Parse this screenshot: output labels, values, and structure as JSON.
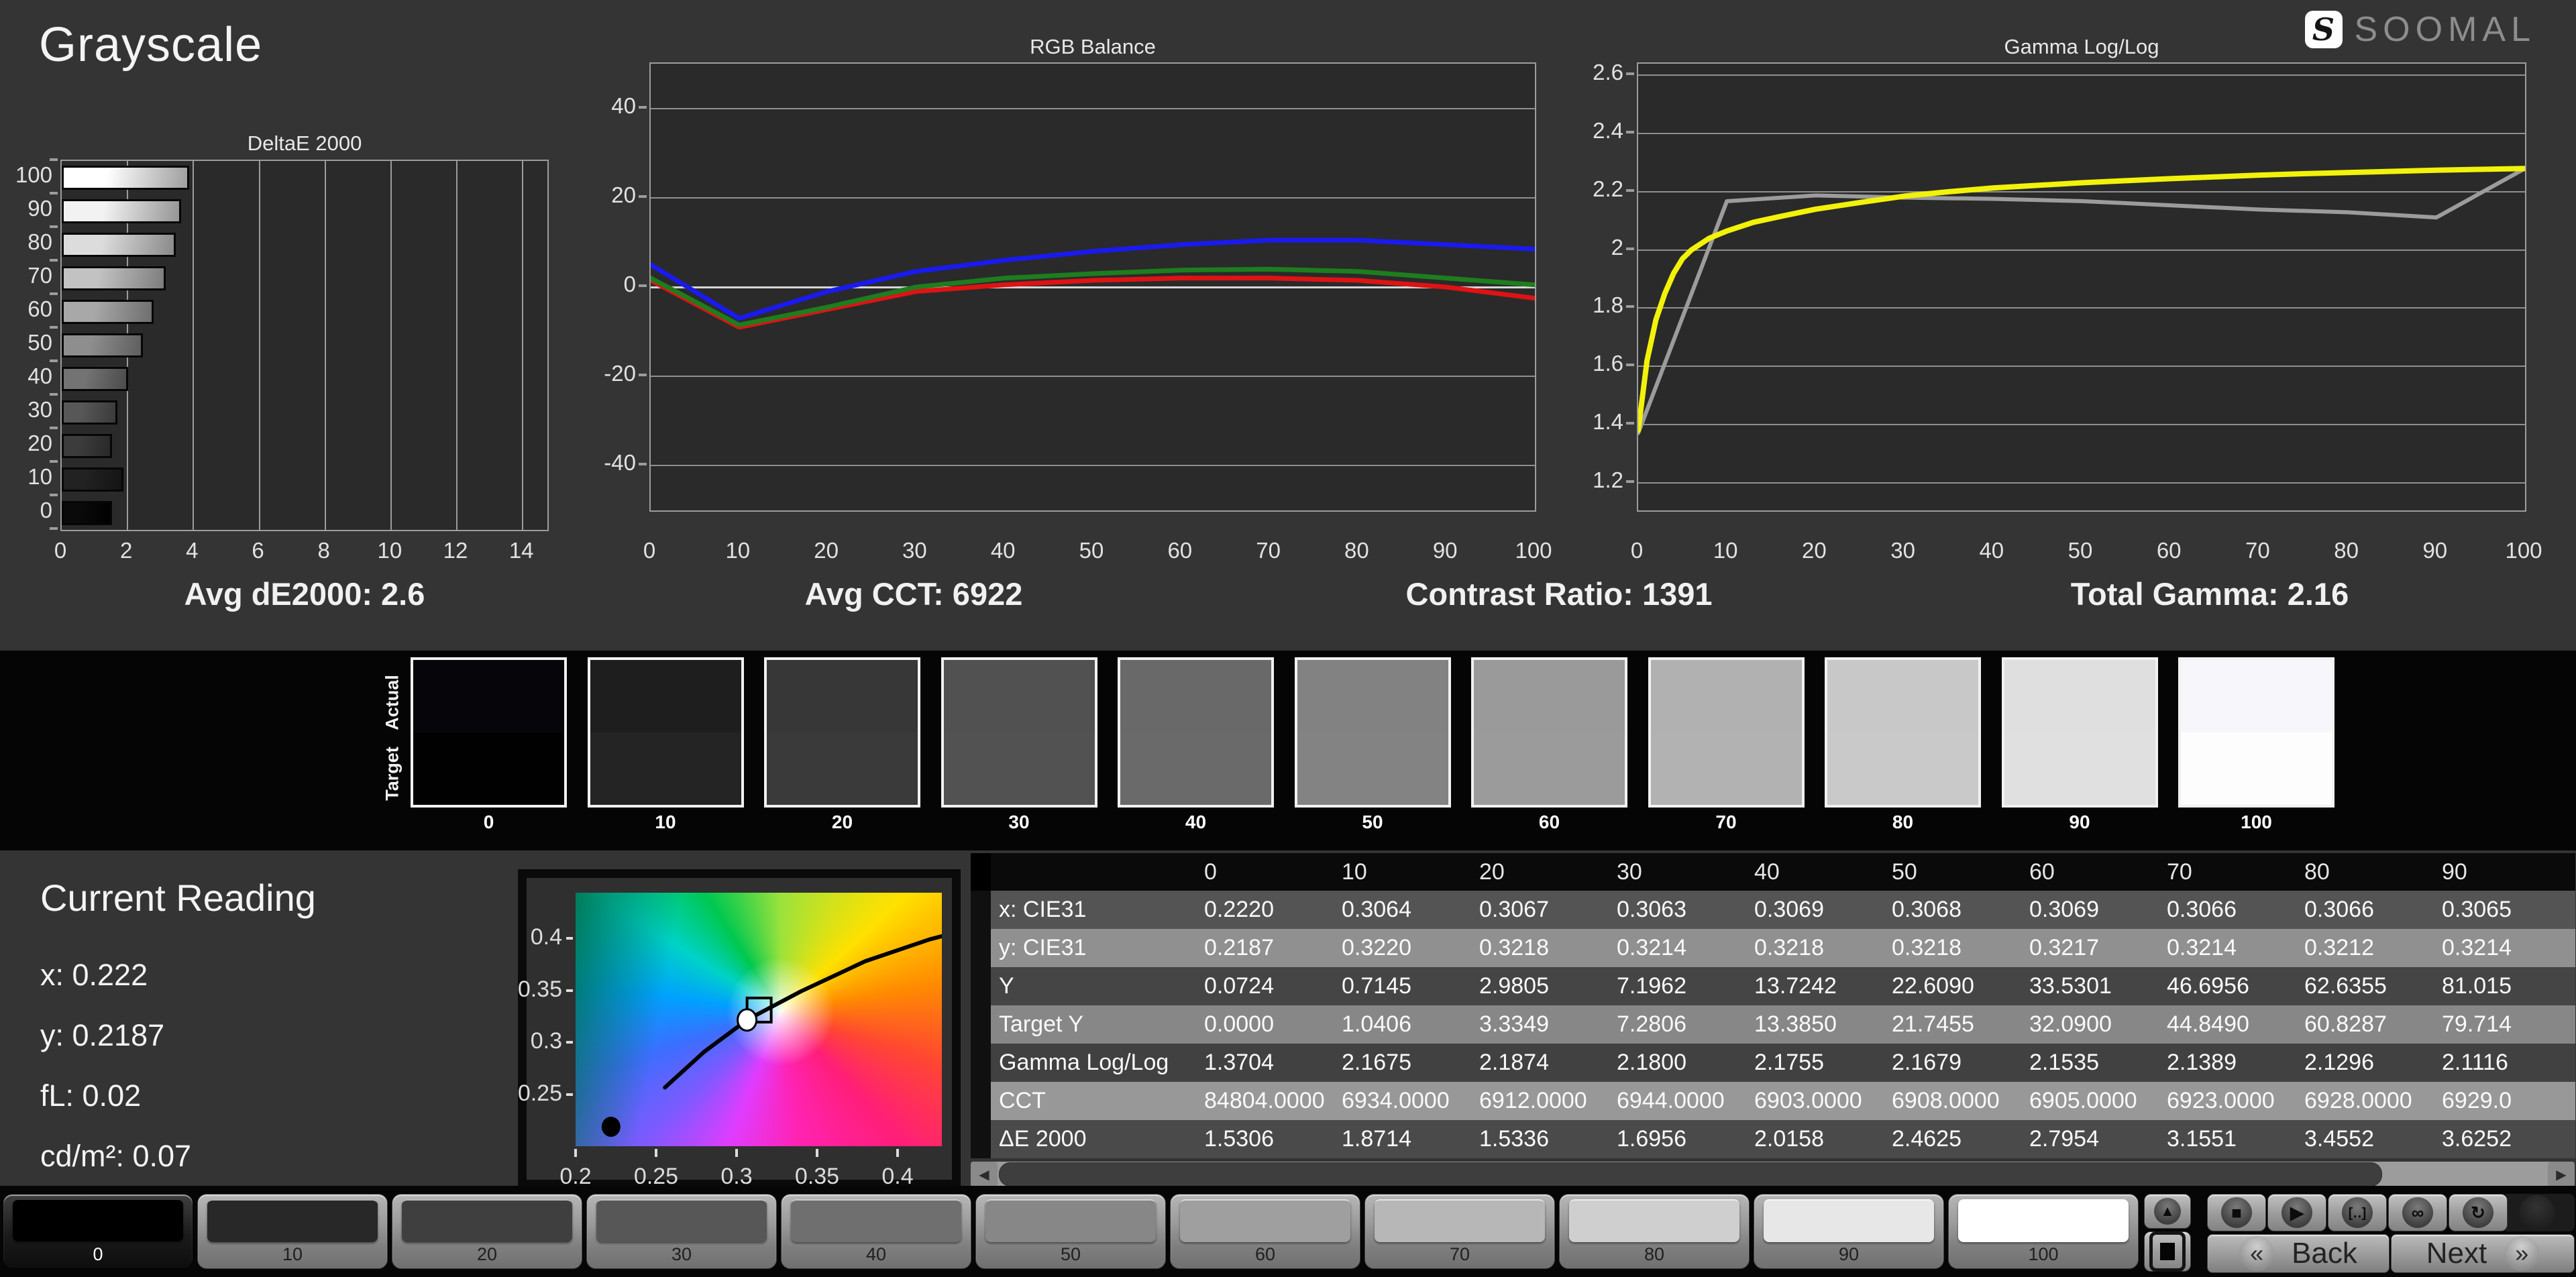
{
  "page": {
    "title": "Grayscale"
  },
  "logo": {
    "text": "SOOMAL",
    "badge_glyph": "S"
  },
  "summary": [
    "Avg dE2000: 2.6",
    "Avg CCT: 6922",
    "Contrast Ratio: 1391",
    "Total Gamma: 2.16"
  ],
  "chart_data": [
    {
      "type": "bar",
      "title": "DeltaE 2000",
      "orientation": "horizontal",
      "categories": [
        "100",
        "90",
        "80",
        "70",
        "60",
        "50",
        "40",
        "30",
        "20",
        "10",
        "0"
      ],
      "values": [
        3.87,
        3.63,
        3.46,
        3.16,
        2.8,
        2.46,
        2.02,
        1.7,
        1.53,
        1.87,
        1.53
      ],
      "xticks": [
        0,
        2,
        4,
        6,
        8,
        10,
        12,
        14
      ],
      "xlim": [
        0,
        14.75
      ],
      "grid": "vertical",
      "bar_colors": [
        {
          "from": "#ffffff",
          "to": "#9e9e9e"
        },
        {
          "from": "#f2f2f2",
          "to": "#959595"
        },
        {
          "from": "#dcdcdc",
          "to": "#8a8a8a"
        },
        {
          "from": "#c2c2c2",
          "to": "#7d7d7d"
        },
        {
          "from": "#a8a8a8",
          "to": "#6e6e6e"
        },
        {
          "from": "#8e8e8e",
          "to": "#5e5e5e"
        },
        {
          "from": "#737373",
          "to": "#4c4c4c"
        },
        {
          "from": "#575757",
          "to": "#3a3a3a"
        },
        {
          "from": "#3c3c3c",
          "to": "#282828"
        },
        {
          "from": "#222222",
          "to": "#141414"
        },
        {
          "from": "#0a0a0a",
          "to": "#000000"
        }
      ]
    },
    {
      "type": "line",
      "title": "RGB Balance",
      "x": [
        0,
        10,
        20,
        30,
        40,
        50,
        60,
        70,
        80,
        90,
        100
      ],
      "xticks": [
        0,
        10,
        20,
        30,
        40,
        50,
        60,
        70,
        80,
        90,
        100
      ],
      "yticks": [
        40,
        20,
        0,
        -20,
        -40
      ],
      "ylim": [
        -50,
        50
      ],
      "grid": "horizontal",
      "series": [
        {
          "name": "red",
          "color": "#de1313",
          "values": [
            1.5,
            -9,
            -5,
            -1,
            0.5,
            1.5,
            2,
            2,
            1.5,
            0,
            -2.5
          ]
        },
        {
          "name": "green",
          "color": "#1e7d1e",
          "values": [
            2,
            -8.5,
            -4.5,
            0,
            2,
            3,
            3.8,
            4,
            3.5,
            2,
            0.5
          ]
        },
        {
          "name": "blue",
          "color": "#1a1aee",
          "values": [
            5,
            -7,
            -1,
            3.5,
            6,
            8,
            9.5,
            10.5,
            10.5,
            9.5,
            8.5
          ]
        }
      ]
    },
    {
      "type": "line",
      "title": "Gamma Log/Log",
      "xticks": [
        0,
        10,
        20,
        30,
        40,
        50,
        60,
        70,
        80,
        90,
        100
      ],
      "yticks": [
        2.6,
        2.4,
        2.2,
        2,
        1.8,
        1.6,
        1.4,
        1.2
      ],
      "ylim": [
        1.105,
        2.64
      ],
      "grid": "horizontal",
      "series": [
        {
          "name": "measured",
          "color": "#9c9c9c",
          "points": [
            [
              0,
              1.3704
            ],
            [
              10,
              2.1675
            ],
            [
              20,
              2.1874
            ],
            [
              30,
              2.18
            ],
            [
              40,
              2.1755
            ],
            [
              50,
              2.1679
            ],
            [
              60,
              2.1535
            ],
            [
              70,
              2.1389
            ],
            [
              80,
              2.1296
            ],
            [
              90,
              2.1116
            ],
            [
              100,
              2.28
            ]
          ]
        },
        {
          "name": "reference",
          "color": "#f2f20a",
          "points": [
            [
              0,
              1.38
            ],
            [
              1,
              1.62
            ],
            [
              2,
              1.76
            ],
            [
              3,
              1.85
            ],
            [
              4,
              1.92
            ],
            [
              5,
              1.97
            ],
            [
              6,
              2.0
            ],
            [
              8,
              2.04
            ],
            [
              10,
              2.065
            ],
            [
              13,
              2.095
            ],
            [
              16,
              2.115
            ],
            [
              20,
              2.14
            ],
            [
              25,
              2.163
            ],
            [
              30,
              2.185
            ],
            [
              35,
              2.2
            ],
            [
              40,
              2.213
            ],
            [
              45,
              2.222
            ],
            [
              50,
              2.231
            ],
            [
              55,
              2.238
            ],
            [
              60,
              2.245
            ],
            [
              65,
              2.251
            ],
            [
              70,
              2.257
            ],
            [
              75,
              2.262
            ],
            [
              80,
              2.266
            ],
            [
              85,
              2.27
            ],
            [
              90,
              2.274
            ],
            [
              95,
              2.277
            ],
            [
              100,
              2.28
            ]
          ]
        }
      ]
    },
    {
      "type": "scatter",
      "title": "",
      "xticks": [
        0.2,
        0.25,
        0.3,
        0.35,
        0.4
      ],
      "yticks": [
        0.4,
        0.35,
        0.3,
        0.25
      ],
      "xlim": [
        0.2,
        0.4275
      ],
      "ylim": [
        0.2,
        0.4439
      ],
      "locus": [
        [
          0.2555,
          0.2565
        ],
        [
          0.28,
          0.291
        ],
        [
          0.307,
          0.322
        ],
        [
          0.34,
          0.349
        ],
        [
          0.38,
          0.378
        ],
        [
          0.42,
          0.399
        ],
        [
          0.4275,
          0.402
        ]
      ],
      "markers": {
        "measured_point": [
          0.222,
          0.2187
        ],
        "white_circle": [
          0.3065,
          0.3215
        ],
        "white_square": [
          0.314,
          0.331
        ]
      }
    }
  ],
  "swatch_strip": {
    "actual_label": "Actual",
    "target_label": "Target",
    "levels": [
      {
        "label": "0",
        "actual": "#06060a",
        "target": "#010101"
      },
      {
        "label": "10",
        "actual": "#1e1e1e",
        "target": "#252424"
      },
      {
        "label": "20",
        "actual": "#373737",
        "target": "#3a3a3a"
      },
      {
        "label": "30",
        "actual": "#515151",
        "target": "#525252"
      },
      {
        "label": "40",
        "actual": "#696969",
        "target": "#6a6a6a"
      },
      {
        "label": "50",
        "actual": "#828282",
        "target": "#838383"
      },
      {
        "label": "60",
        "actual": "#9a9a9a",
        "target": "#9b9b9b"
      },
      {
        "label": "70",
        "actual": "#b1b1b1",
        "target": "#b2b2b2"
      },
      {
        "label": "80",
        "actual": "#c8c8c8",
        "target": "#c9c9c9"
      },
      {
        "label": "90",
        "actual": "#dfdfdf",
        "target": "#e0e0e0"
      },
      {
        "label": "100",
        "actual": "#f7f7fb",
        "target": "#fdfdfd"
      }
    ]
  },
  "current_reading": {
    "title": "Current Reading",
    "lines": [
      "x: 0.222",
      "y: 0.2187",
      "fL: 0.02",
      "cd/m²: 0.07"
    ]
  },
  "table": {
    "columns": [
      "0",
      "10",
      "20",
      "30",
      "40",
      "50",
      "60",
      "70",
      "80",
      "90"
    ],
    "rows": [
      {
        "label": "x: CIE31",
        "bg": "#545454",
        "values": [
          "0.2220",
          "0.3064",
          "0.3067",
          "0.3063",
          "0.3069",
          "0.3068",
          "0.3069",
          "0.3066",
          "0.3066",
          "0.3065"
        ]
      },
      {
        "label": "y: CIE31",
        "bg": "#909090",
        "values": [
          "0.2187",
          "0.3220",
          "0.3218",
          "0.3214",
          "0.3218",
          "0.3218",
          "0.3217",
          "0.3214",
          "0.3212",
          "0.3214"
        ]
      },
      {
        "label": "Y",
        "bg": "#454545",
        "values": [
          "0.0724",
          "0.7145",
          "2.9805",
          "7.1962",
          "13.7242",
          "22.6090",
          "33.5301",
          "46.6956",
          "62.6355",
          "81.015"
        ]
      },
      {
        "label": "Target Y",
        "bg": "#878787",
        "values": [
          "0.0000",
          "1.0406",
          "3.3349",
          "7.2806",
          "13.3850",
          "21.7455",
          "32.0900",
          "44.8490",
          "60.8287",
          "79.714"
        ]
      },
      {
        "label": "Gamma Log/Log",
        "bg": "#414141",
        "values": [
          "1.3704",
          "2.1675",
          "2.1874",
          "2.1800",
          "2.1755",
          "2.1679",
          "2.1535",
          "2.1389",
          "2.1296",
          "2.1116"
        ]
      },
      {
        "label": "CCT",
        "bg": "#989898",
        "values": [
          "84804.0000",
          "6934.0000",
          "6912.0000",
          "6944.0000",
          "6903.0000",
          "6908.0000",
          "6905.0000",
          "6923.0000",
          "6928.0000",
          "6929.0"
        ]
      },
      {
        "label": "ΔE 2000",
        "bg": "#4a4a4a",
        "values": [
          "1.5306",
          "1.8714",
          "1.5336",
          "1.6956",
          "2.0158",
          "2.4625",
          "2.7954",
          "3.1551",
          "3.4552",
          "3.6252"
        ]
      }
    ]
  },
  "bottom_bar": {
    "tiles": [
      {
        "label": "0",
        "color": "#000000",
        "selected": true
      },
      {
        "label": "10",
        "color": "#282828",
        "selected": false
      },
      {
        "label": "20",
        "color": "#3f3f3f",
        "selected": false
      },
      {
        "label": "30",
        "color": "#575757",
        "selected": false
      },
      {
        "label": "40",
        "color": "#6f6f6f",
        "selected": false
      },
      {
        "label": "50",
        "color": "#878787",
        "selected": false
      },
      {
        "label": "60",
        "color": "#9f9f9f",
        "selected": false
      },
      {
        "label": "70",
        "color": "#b7b7b7",
        "selected": false
      },
      {
        "label": "80",
        "color": "#cfcfcf",
        "selected": false
      },
      {
        "label": "90",
        "color": "#e7e7e7",
        "selected": false
      },
      {
        "label": "100",
        "color": "#ffffff",
        "selected": false
      }
    ],
    "transport": [
      {
        "name": "stop-icon",
        "glyph": "■"
      },
      {
        "name": "play-icon",
        "glyph": "▶"
      },
      {
        "name": "interval-icon",
        "glyph": "[‥]"
      },
      {
        "name": "infinity-icon",
        "glyph": "∞"
      },
      {
        "name": "refresh-icon",
        "glyph": "↻"
      }
    ],
    "up_glyph": "▲",
    "back_label": "Back",
    "next_label": "Next",
    "back_chevron": "«",
    "next_chevron": "»",
    "scroll_left_glyph": "◀",
    "scroll_right_glyph": "▶"
  }
}
